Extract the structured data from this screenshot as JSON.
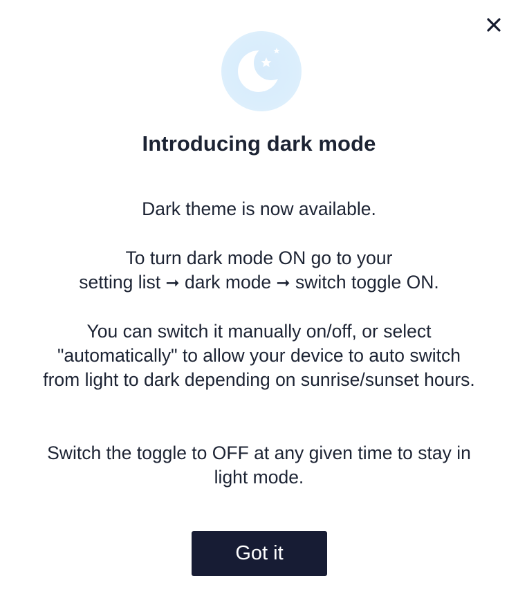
{
  "dialog": {
    "close_icon": "close-icon",
    "hero_icon": "moon-stars-icon",
    "title": "Introducing dark mode",
    "paragraph_1": "Dark theme is now available.",
    "paragraph_2_line_1": "To turn dark mode ON go to your",
    "paragraph_2_line_2_a": "setting list",
    "paragraph_2_line_2_b": "dark mode",
    "paragraph_2_line_2_c": "switch toggle ON.",
    "arrow_glyph": "➞",
    "paragraph_3": "You can switch it manually on/off, or select \"automatically\" to allow your device to auto switch from light to dark depending on sunrise/sunset hours.",
    "paragraph_4": "Switch the toggle to OFF at any given time to stay in light mode.",
    "confirm_label": "Got it"
  },
  "colors": {
    "text": "#1c2333",
    "button_bg": "#171c34",
    "button_text": "#ffffff",
    "hero_circle": "#dbeefc",
    "background": "#ffffff"
  }
}
